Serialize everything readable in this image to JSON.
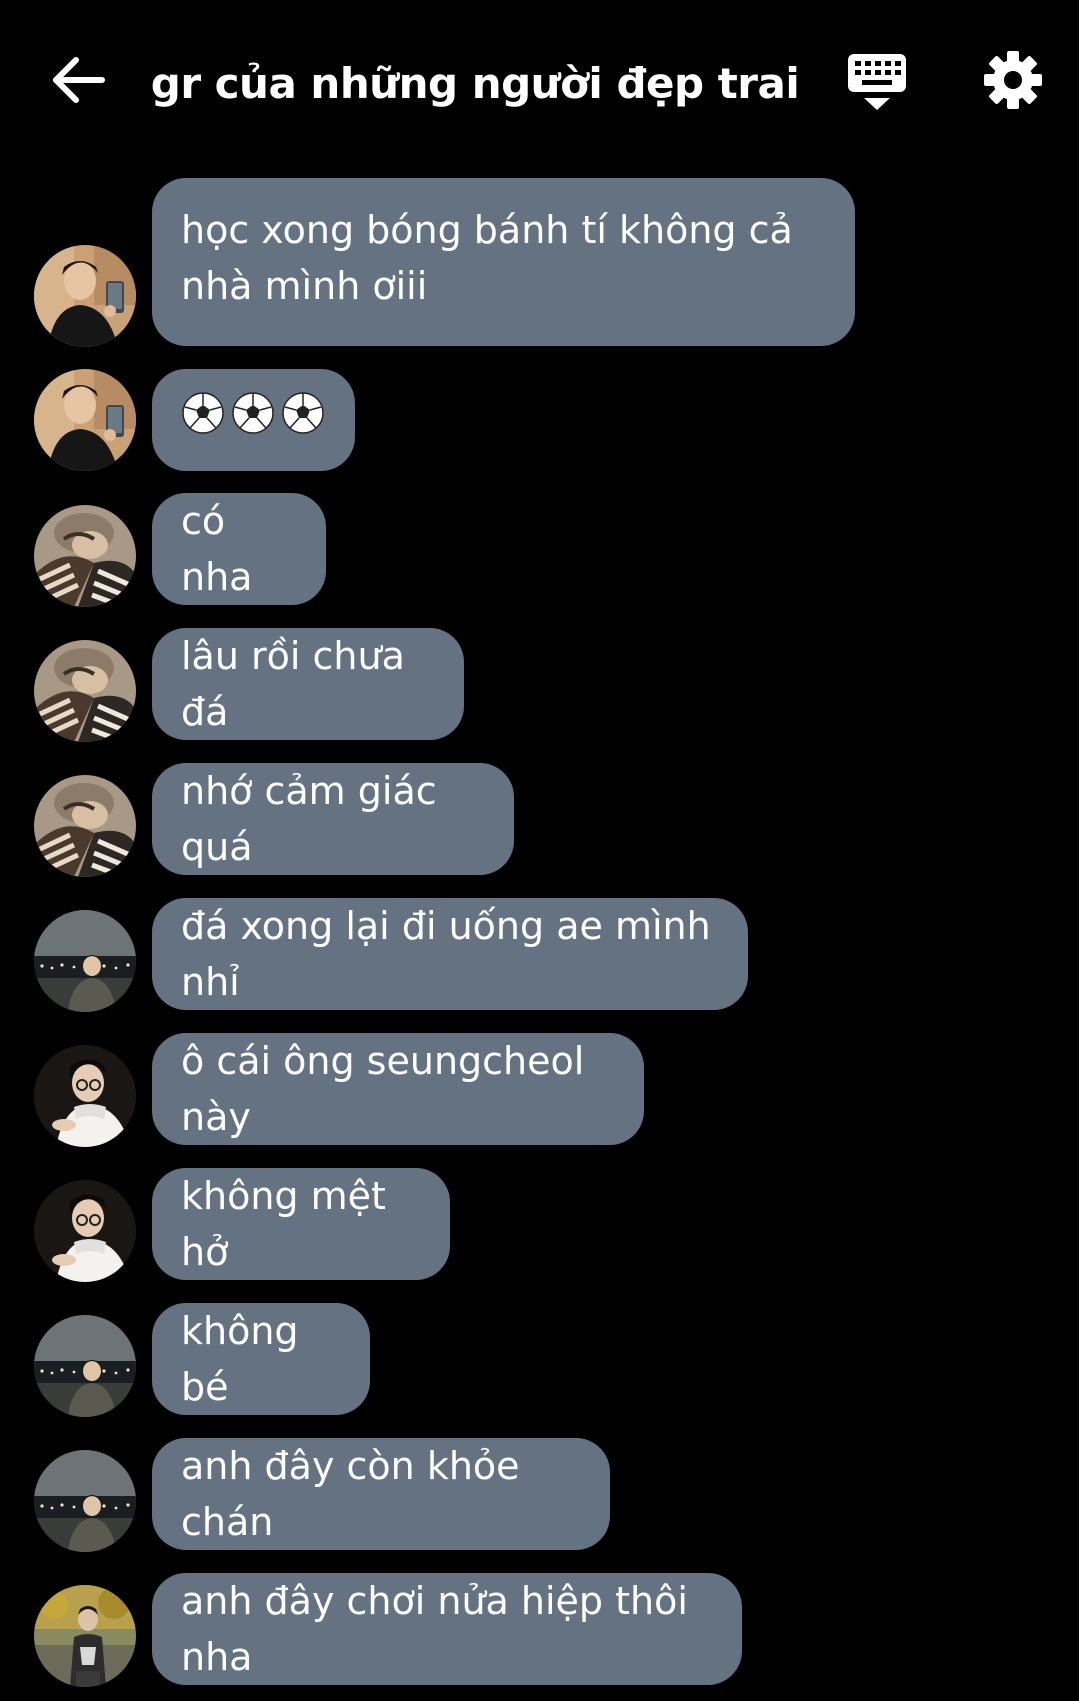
{
  "header": {
    "title": "gr của những người đẹp trai",
    "back_icon": "arrow-left-icon",
    "keyboard_icon": "keyboard-hide-icon",
    "settings_icon": "gear-icon"
  },
  "colors": {
    "background": "#000000",
    "bubble": "#647282",
    "text": "#ffffff"
  },
  "messages": [
    {
      "sender_avatar": "avatar-a",
      "text": "học xong bóng bánh tí không cả nhà mình ơiii"
    },
    {
      "sender_avatar": "avatar-a",
      "text": "⚽⚽⚽"
    },
    {
      "sender_avatar": "avatar-b",
      "text": "có nha"
    },
    {
      "sender_avatar": "avatar-b",
      "text": "lâu rồi chưa đá"
    },
    {
      "sender_avatar": "avatar-b",
      "text": "nhớ cảm giác quá"
    },
    {
      "sender_avatar": "avatar-c",
      "text": "đá xong lại đi uống ae mình nhỉ"
    },
    {
      "sender_avatar": "avatar-d",
      "text": "ô cái ông seungcheol này"
    },
    {
      "sender_avatar": "avatar-d",
      "text": "không mệt hở"
    },
    {
      "sender_avatar": "avatar-c",
      "text": "không bé"
    },
    {
      "sender_avatar": "avatar-c",
      "text": "anh đây còn khỏe chán"
    },
    {
      "sender_avatar": "avatar-e",
      "text": "anh đây chơi nửa hiệp thôi nha"
    }
  ]
}
